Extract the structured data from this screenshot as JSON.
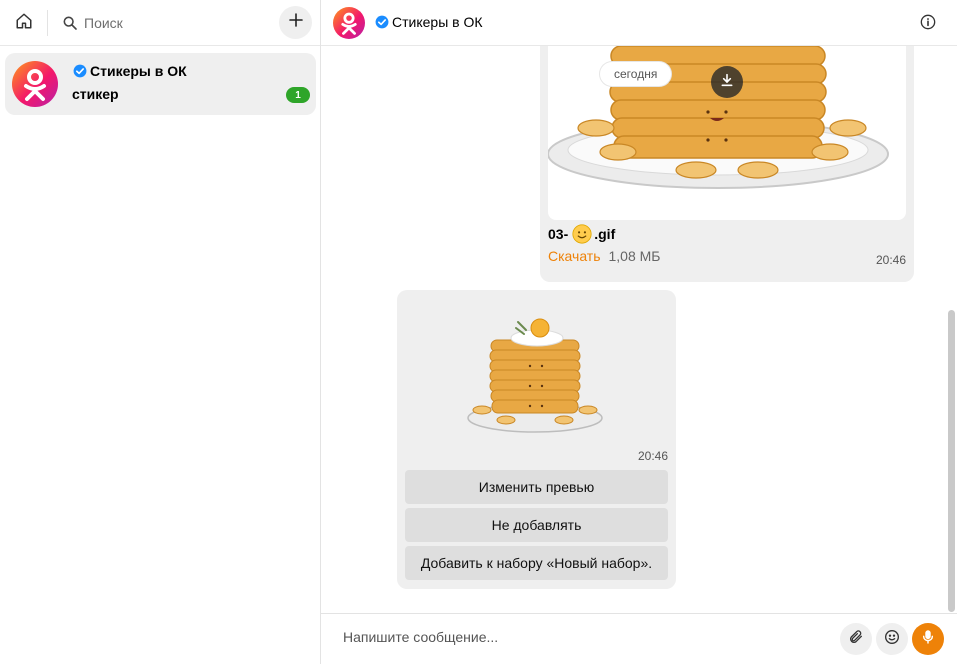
{
  "sidebar": {
    "search_placeholder": "Поиск",
    "chats": [
      {
        "name": "Стикеры в ОК",
        "last_message": "стикер",
        "unread": "1",
        "verified": true
      }
    ]
  },
  "chat": {
    "title": "Стикеры в ОК",
    "date_chip": "сегодня",
    "file_message": {
      "name_prefix": "03-",
      "name_suffix": ".gif",
      "download_label": "Скачать",
      "size": "1,08 МБ",
      "time": "20:46"
    },
    "sticker_message": {
      "time": "20:46",
      "buttons": [
        "Изменить превью",
        "Не добавлять",
        "Добавить к набору «Новый набор»."
      ]
    }
  },
  "composer": {
    "placeholder": "Напишите сообщение..."
  },
  "colors": {
    "accent": "#ee8208",
    "unread_badge": "#2ea529",
    "verified": "#1a8cff",
    "bubble": "#efefef"
  },
  "icons": [
    "home-icon",
    "search-icon",
    "plus-icon",
    "verified-icon",
    "info-icon",
    "download-icon",
    "paperclip-icon",
    "smile-icon",
    "microphone-icon"
  ]
}
